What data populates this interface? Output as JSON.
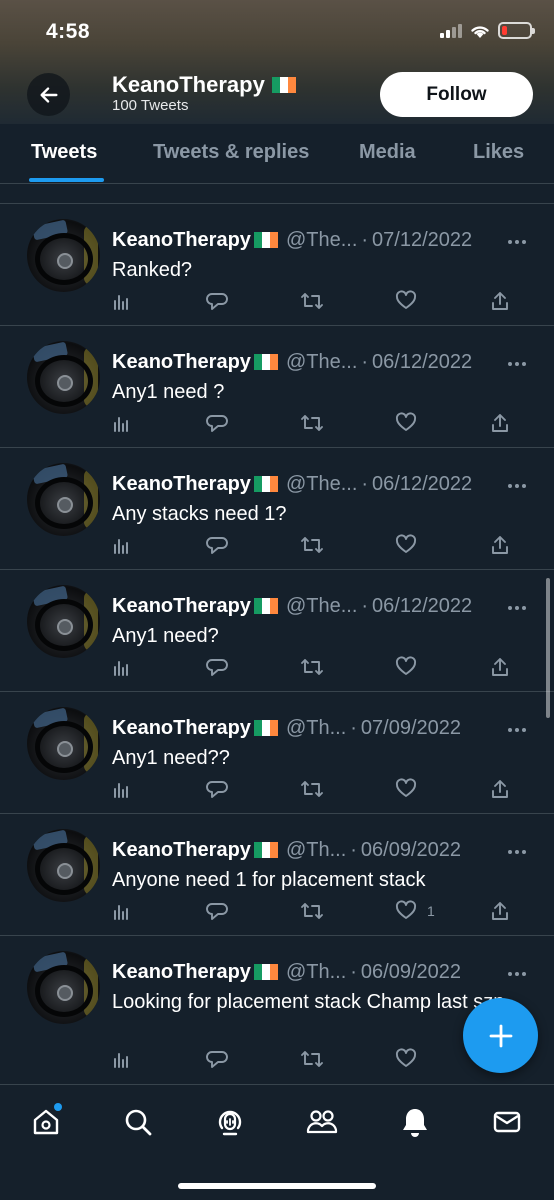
{
  "status_bar": {
    "time": "4:58"
  },
  "profile_header": {
    "name": "KeanoTherapy",
    "tweet_count": "100 Tweets",
    "follow_label": "Follow"
  },
  "tabs": [
    {
      "label": "Tweets",
      "active": true
    },
    {
      "label": "Tweets & replies",
      "active": false
    },
    {
      "label": "Media",
      "active": false
    },
    {
      "label": "Likes",
      "active": false
    }
  ],
  "tweets": [
    {
      "name": "KeanoTherapy",
      "handle": "@The...",
      "date": "07/12/2022",
      "text": "Ranked?",
      "likes": ""
    },
    {
      "name": "KeanoTherapy",
      "handle": "@The...",
      "date": "06/12/2022",
      "text": "Any1 need ?",
      "likes": ""
    },
    {
      "name": "KeanoTherapy",
      "handle": "@The...",
      "date": "06/12/2022",
      "text": "Any stacks need 1?",
      "likes": ""
    },
    {
      "name": "KeanoTherapy",
      "handle": "@The...",
      "date": "06/12/2022",
      "text": "Any1 need?",
      "likes": ""
    },
    {
      "name": "KeanoTherapy",
      "handle": "@Th...",
      "date": "07/09/2022",
      "text": "Any1 need??",
      "likes": ""
    },
    {
      "name": "KeanoTherapy",
      "handle": "@Th...",
      "date": "06/09/2022",
      "text": "Anyone need 1 for placement stack",
      "likes": "1"
    },
    {
      "name": "KeanoTherapy",
      "handle": "@Th...",
      "date": "06/09/2022",
      "text": "Looking for placement stack Champ last szn",
      "likes": ""
    }
  ],
  "separator": "·",
  "colors": {
    "accent": "#1d9bf0",
    "background": "#15202b",
    "muted": "#8b98a5"
  },
  "bottom_nav": [
    "home-icon",
    "search-icon",
    "spaces-icon",
    "communities-icon",
    "notifications-icon",
    "messages-icon"
  ],
  "fab_icon": "plus-icon"
}
